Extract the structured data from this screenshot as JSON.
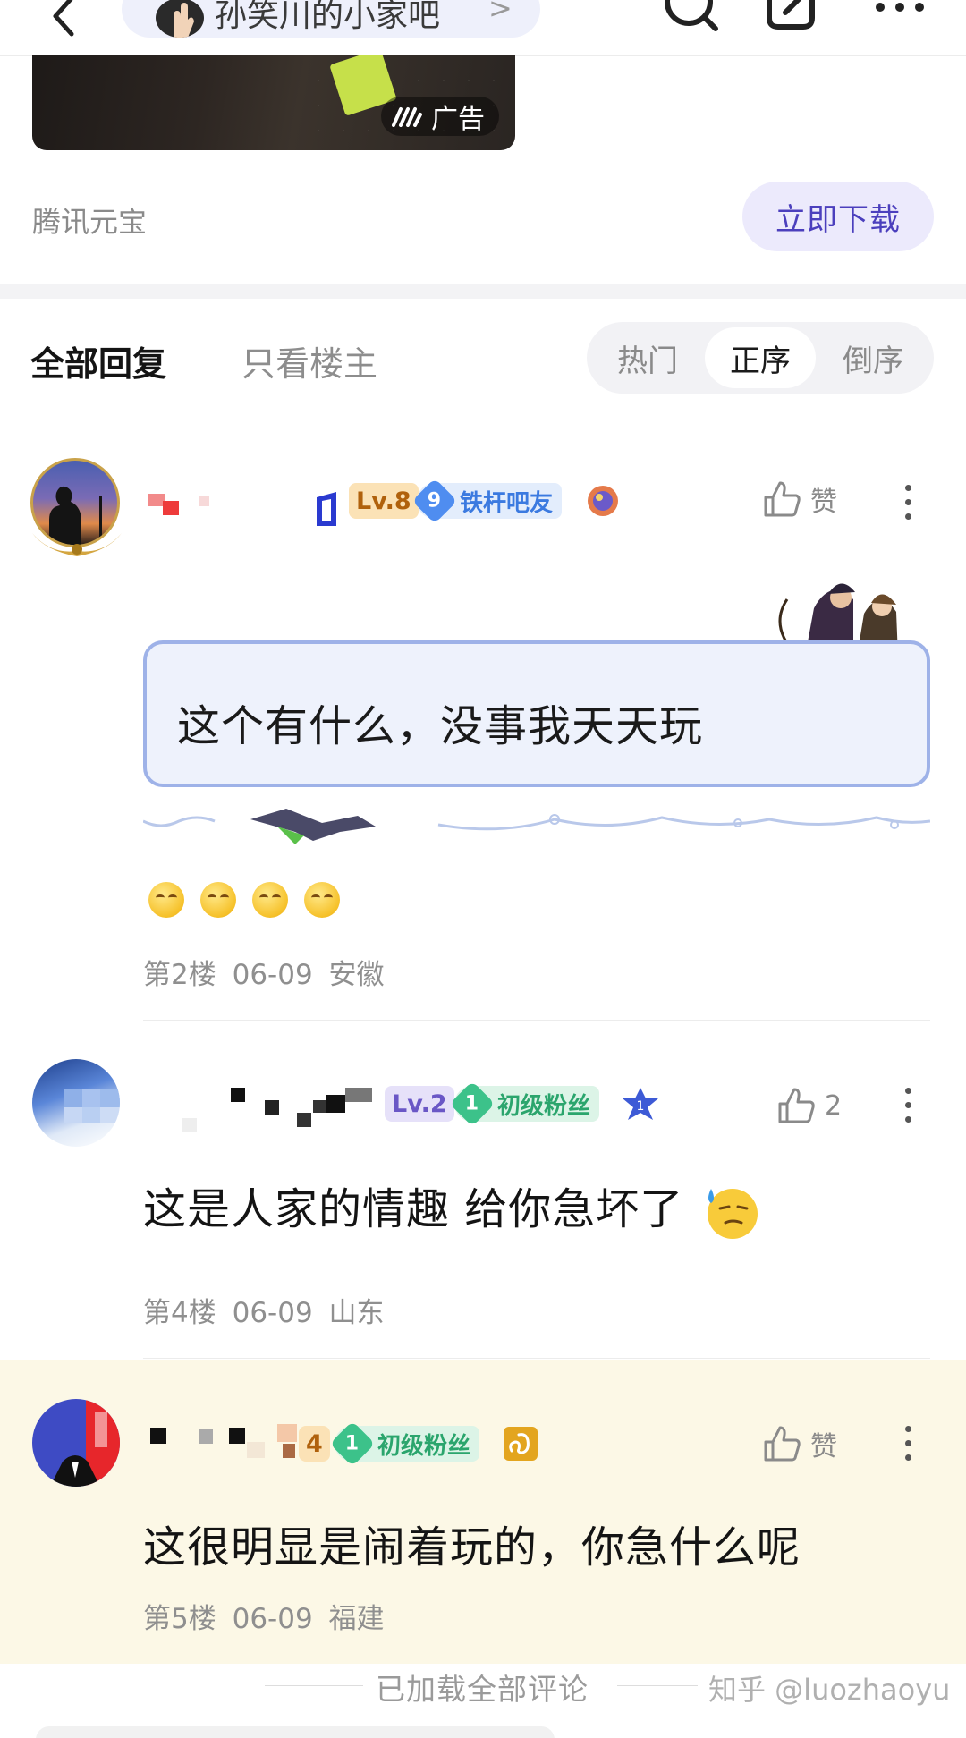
{
  "top_bar": {
    "forum_name": "孙笑川的小家吧",
    "arrow": ">"
  },
  "ad": {
    "badge": "广告",
    "source": "腾讯元宝",
    "download_label": "立即下载"
  },
  "reply_tabs": {
    "all": "全部回复",
    "owner_only": "只看楼主",
    "sort": [
      "热门",
      "正序",
      "倒序"
    ],
    "active_sort": "正序"
  },
  "comments": [
    {
      "level": "Lv.8",
      "tier_number": "9",
      "tier_title": "铁杆吧友",
      "like_label": "赞",
      "text": "这个有什么，没事我天天玩",
      "emoji_count": 4,
      "floor": "第2楼",
      "date": "06-09",
      "location": "安徽"
    },
    {
      "level": "Lv.2",
      "tier_number": "1",
      "tier_title": "初级粉丝",
      "like_count": "2",
      "text": "这是人家的情趣 给你急坏了",
      "floor": "第4楼",
      "date": "06-09",
      "location": "山东"
    },
    {
      "level": "4",
      "tier_number": "1",
      "tier_title": "初级粉丝",
      "like_label": "赞",
      "text": "这很明显是闹着玩的，你急什么呢",
      "floor": "第5楼",
      "date": "06-09",
      "location": "福建"
    }
  ],
  "footer": {
    "loaded_all": "已加载全部评论",
    "watermark": "知乎 @luozhaoyu"
  },
  "colors": {
    "accent_purple": "#4b3fbd",
    "bubble_border": "#9eb2e8",
    "tier_green": "#3cc28a",
    "tier_blue": "#4f8df0",
    "highlight_bg": "#fcf8e6"
  }
}
